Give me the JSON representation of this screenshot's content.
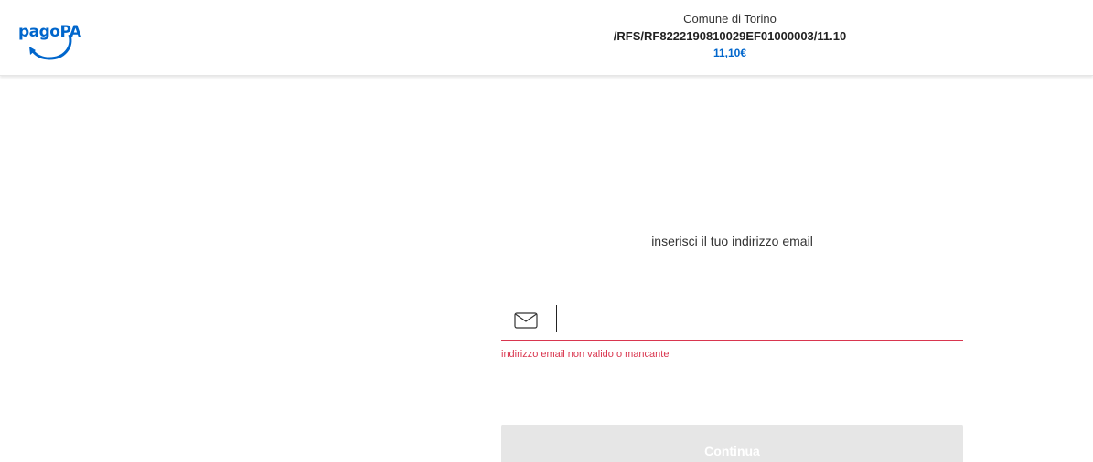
{
  "header": {
    "logo_text": "pagoPA",
    "payee": "Comune di Torino",
    "notice_code": "/RFS/RF8222190810029EF01000003/11.10",
    "amount": "11,10€"
  },
  "form": {
    "prompt": "inserisci il tuo indirizzo email",
    "email_value": "",
    "email_placeholder": "",
    "icon": "envelope-icon",
    "error_message": "indirizzo email non valido o mancante",
    "submit_label": "Continua"
  },
  "colors": {
    "brand": "#0066cc",
    "error": "#d9364f",
    "button_disabled": "#e6e6e6"
  }
}
